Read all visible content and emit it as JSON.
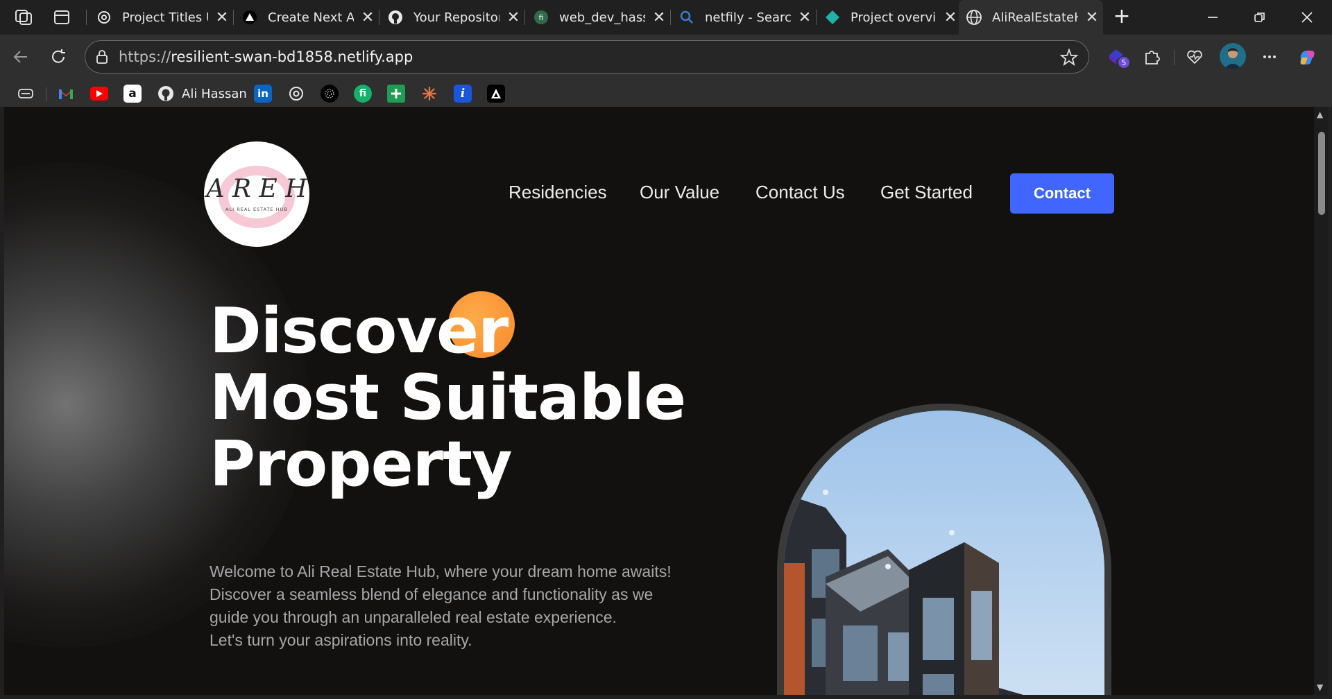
{
  "browser": {
    "tabs": [
      {
        "title": "Project Titles U",
        "icon": "openai-icon"
      },
      {
        "title": "Create Next Ap",
        "icon": "vercel-icon"
      },
      {
        "title": "Your Repositor",
        "icon": "github-icon"
      },
      {
        "title": "web_dev_hassa",
        "icon": "fi-icon"
      },
      {
        "title": "netfily - Search",
        "icon": "search-icon"
      },
      {
        "title": "Project overvie",
        "icon": "netlify-icon"
      },
      {
        "title": "AliRealEstateHu",
        "icon": "globe-icon"
      }
    ],
    "url_scheme": "https://",
    "url_host": "resilient-swan-bd1858.netlify.app",
    "extension_badge": "5",
    "bookmarks": [
      {
        "label": "",
        "icon": "bookmark-bar-icon"
      },
      {
        "label": "",
        "icon": "gmail-icon",
        "color": "#ea4335"
      },
      {
        "label": "",
        "icon": "youtube-icon",
        "color": "#ff0000"
      },
      {
        "label": "",
        "icon": "amazon-icon",
        "color": "#ffffff"
      },
      {
        "label": "Ali Hassan",
        "icon": "github-icon"
      },
      {
        "label": "",
        "icon": "linkedin-icon",
        "color": "#0a66c2"
      },
      {
        "label": "",
        "icon": "openai-icon"
      },
      {
        "label": "",
        "icon": "perplexity-icon"
      },
      {
        "label": "",
        "icon": "fi-icon",
        "color": "#15b06a"
      },
      {
        "label": "",
        "icon": "sheets-plus-icon",
        "color": "#1f9d55"
      },
      {
        "label": "",
        "icon": "claude-icon",
        "color": "#e6764a"
      },
      {
        "label": "",
        "icon": "info-icon",
        "color": "#1a56db"
      },
      {
        "label": "",
        "icon": "vercel-icon",
        "color": "#000000"
      }
    ]
  },
  "site": {
    "logo_text": "A R E H",
    "logo_subtext": "ALI REAL ESTATE HUB",
    "nav": [
      "Residencies",
      "Our Value",
      "Contact Us",
      "Get Started"
    ],
    "contact_button": "Contact",
    "hero_title": [
      "Discover",
      "Most Suitable",
      "Property"
    ],
    "hero_description": [
      "Welcome to Ali Real Estate Hub, where your dream home awaits!",
      "Discover a seamless blend of elegance and functionality as we",
      "guide you through an unparalleled real estate experience.",
      "Let's turn your aspirations into reality."
    ],
    "colors": {
      "accent_blue": "#4066ff",
      "orb_orange": "#f7892b",
      "background": "#131110",
      "description_gray": "#a7a7a7"
    }
  }
}
